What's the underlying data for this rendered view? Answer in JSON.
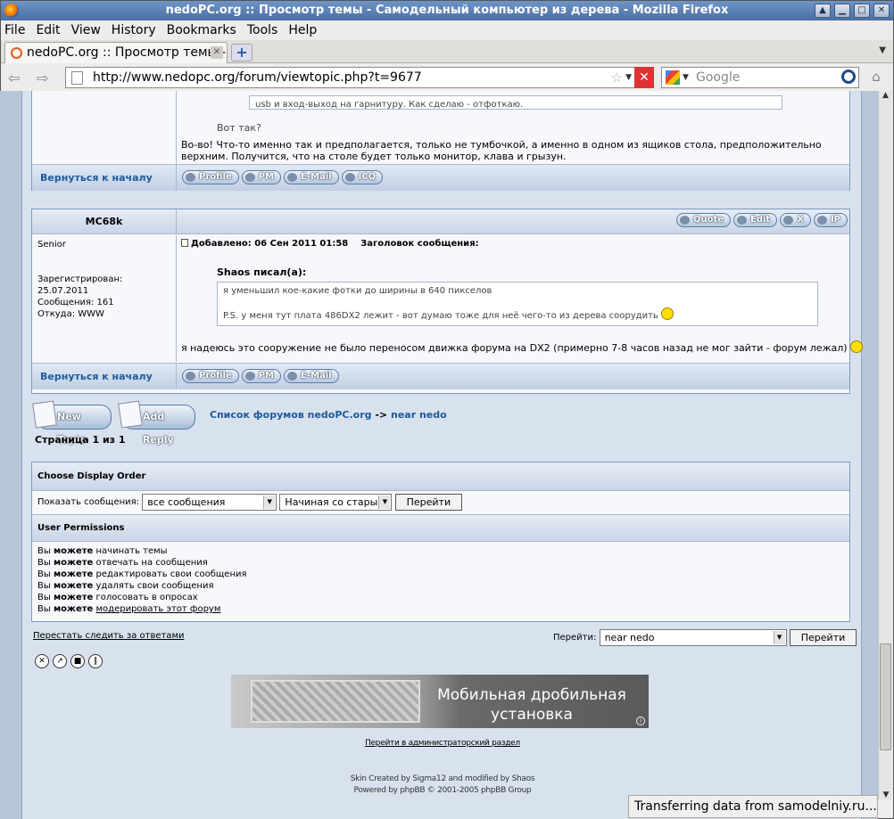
{
  "window": {
    "title": "nedoPC.org :: Просмотр темы - Самодельный компьютер из дерева - Mozilla Firefox"
  },
  "menu": [
    "File",
    "Edit",
    "View",
    "History",
    "Bookmarks",
    "Tools",
    "Help"
  ],
  "tab": {
    "title": "nedoPC.org :: Просмотр темы -..."
  },
  "nav": {
    "url": "http://www.nedopc.org/forum/viewtopic.php?t=9677",
    "search_placeholder": "Google"
  },
  "prev_post": {
    "quote_tail": "usb и вход-выход на гарнитуру. Как сделаю - отфоткаю.",
    "quote_after": "Вот так?",
    "body": "Во-во! Что-то именно так и предполагается, только не тумбочкой, а именно в одном из ящиков стола, предположительно верхним. Получится, что на столе будет только монитор, клава и грызун.",
    "back_link": "Вернуться к началу",
    "buttons": [
      "Profile",
      "PM",
      "E-Mail",
      "ICQ"
    ]
  },
  "post": {
    "author": "MC68k",
    "rank": "Senior",
    "registered": "Зарегистрирован: 25.07.2011",
    "messages": "Сообщения: 161",
    "from": "Откуда: WWW",
    "header": "Добавлено: 06 Сен 2011 01:58    Заголовок сообщения:",
    "action_buttons": [
      "Quote",
      "Edit",
      "X",
      "IP"
    ],
    "quote_title": "Shaos писал(а):",
    "quote_line1": "я уменьшил кое-какие фотки до ширины в 640 пикселов",
    "quote_line2": "P.S. у меня тут плата 486DX2 лежит - вот думаю тоже для неё чего-то из дерева соорудить",
    "body": "я надеюсь это сооружение не было переносом движка форума на DX2 (примерно 7-8 часов назад не мог зайти - форум лежал)",
    "back_link": "Вернуться к началу",
    "buttons": [
      "Profile",
      "PM",
      "E-Mail"
    ]
  },
  "actions": {
    "new_topic": "New Topic",
    "add_reply": "Add Reply"
  },
  "breadcrumb": {
    "forum_list": "Список форумов nedoPC.org",
    "sep": "->",
    "forum": "near nedo"
  },
  "pagination": "Страница 1 из 1",
  "display_order": {
    "heading": "Choose Display Order",
    "label": "Показать сообщения:",
    "filter": "все сообщения",
    "order": "Начиная со старых",
    "go": "Перейти"
  },
  "permissions": {
    "heading": "User Permissions",
    "prefix": "Вы",
    "can": "можете",
    "items": [
      "начинать темы",
      "отвечать на сообщения",
      "редактировать свои сообщения",
      "удалять свои сообщения",
      "голосовать в опросах",
      "модерировать этот форум"
    ]
  },
  "unwatch": "Перестать следить за ответами",
  "jump": {
    "label": "Перейти:",
    "value": "near nedo",
    "go": "Перейти"
  },
  "ad": {
    "text_line1": "Мобильная дробильная",
    "text_line2": "установка"
  },
  "admin_link": "Перейти в администраторский раздел",
  "footer": {
    "skin": "Skin Created by Sigma12 and modified by Shaos",
    "powered": "Powered by phpBB © 2001-2005 phpBB Group"
  },
  "status": "Transferring data from samodelniy.ru..."
}
